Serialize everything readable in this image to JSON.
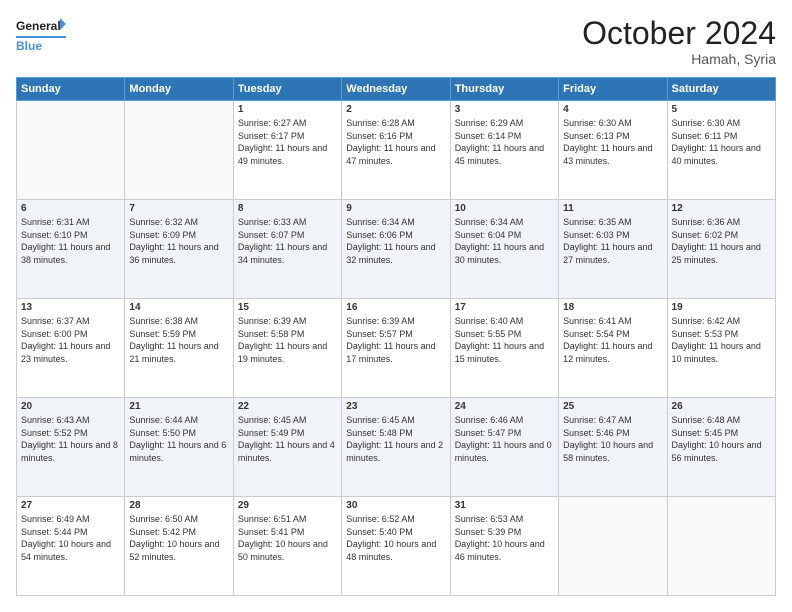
{
  "logo": {
    "line1": "General",
    "line2": "Blue"
  },
  "header": {
    "month": "October 2024",
    "location": "Hamah, Syria"
  },
  "weekdays": [
    "Sunday",
    "Monday",
    "Tuesday",
    "Wednesday",
    "Thursday",
    "Friday",
    "Saturday"
  ],
  "rows": [
    [
      {
        "day": "",
        "info": ""
      },
      {
        "day": "",
        "info": ""
      },
      {
        "day": "1",
        "info": "Sunrise: 6:27 AM\nSunset: 6:17 PM\nDaylight: 11 hours and 49 minutes."
      },
      {
        "day": "2",
        "info": "Sunrise: 6:28 AM\nSunset: 6:16 PM\nDaylight: 11 hours and 47 minutes."
      },
      {
        "day": "3",
        "info": "Sunrise: 6:29 AM\nSunset: 6:14 PM\nDaylight: 11 hours and 45 minutes."
      },
      {
        "day": "4",
        "info": "Sunrise: 6:30 AM\nSunset: 6:13 PM\nDaylight: 11 hours and 43 minutes."
      },
      {
        "day": "5",
        "info": "Sunrise: 6:30 AM\nSunset: 6:11 PM\nDaylight: 11 hours and 40 minutes."
      }
    ],
    [
      {
        "day": "6",
        "info": "Sunrise: 6:31 AM\nSunset: 6:10 PM\nDaylight: 11 hours and 38 minutes."
      },
      {
        "day": "7",
        "info": "Sunrise: 6:32 AM\nSunset: 6:09 PM\nDaylight: 11 hours and 36 minutes."
      },
      {
        "day": "8",
        "info": "Sunrise: 6:33 AM\nSunset: 6:07 PM\nDaylight: 11 hours and 34 minutes."
      },
      {
        "day": "9",
        "info": "Sunrise: 6:34 AM\nSunset: 6:06 PM\nDaylight: 11 hours and 32 minutes."
      },
      {
        "day": "10",
        "info": "Sunrise: 6:34 AM\nSunset: 6:04 PM\nDaylight: 11 hours and 30 minutes."
      },
      {
        "day": "11",
        "info": "Sunrise: 6:35 AM\nSunset: 6:03 PM\nDaylight: 11 hours and 27 minutes."
      },
      {
        "day": "12",
        "info": "Sunrise: 6:36 AM\nSunset: 6:02 PM\nDaylight: 11 hours and 25 minutes."
      }
    ],
    [
      {
        "day": "13",
        "info": "Sunrise: 6:37 AM\nSunset: 6:00 PM\nDaylight: 11 hours and 23 minutes."
      },
      {
        "day": "14",
        "info": "Sunrise: 6:38 AM\nSunset: 5:59 PM\nDaylight: 11 hours and 21 minutes."
      },
      {
        "day": "15",
        "info": "Sunrise: 6:39 AM\nSunset: 5:58 PM\nDaylight: 11 hours and 19 minutes."
      },
      {
        "day": "16",
        "info": "Sunrise: 6:39 AM\nSunset: 5:57 PM\nDaylight: 11 hours and 17 minutes."
      },
      {
        "day": "17",
        "info": "Sunrise: 6:40 AM\nSunset: 5:55 PM\nDaylight: 11 hours and 15 minutes."
      },
      {
        "day": "18",
        "info": "Sunrise: 6:41 AM\nSunset: 5:54 PM\nDaylight: 11 hours and 12 minutes."
      },
      {
        "day": "19",
        "info": "Sunrise: 6:42 AM\nSunset: 5:53 PM\nDaylight: 11 hours and 10 minutes."
      }
    ],
    [
      {
        "day": "20",
        "info": "Sunrise: 6:43 AM\nSunset: 5:52 PM\nDaylight: 11 hours and 8 minutes."
      },
      {
        "day": "21",
        "info": "Sunrise: 6:44 AM\nSunset: 5:50 PM\nDaylight: 11 hours and 6 minutes."
      },
      {
        "day": "22",
        "info": "Sunrise: 6:45 AM\nSunset: 5:49 PM\nDaylight: 11 hours and 4 minutes."
      },
      {
        "day": "23",
        "info": "Sunrise: 6:45 AM\nSunset: 5:48 PM\nDaylight: 11 hours and 2 minutes."
      },
      {
        "day": "24",
        "info": "Sunrise: 6:46 AM\nSunset: 5:47 PM\nDaylight: 11 hours and 0 minutes."
      },
      {
        "day": "25",
        "info": "Sunrise: 6:47 AM\nSunset: 5:46 PM\nDaylight: 10 hours and 58 minutes."
      },
      {
        "day": "26",
        "info": "Sunrise: 6:48 AM\nSunset: 5:45 PM\nDaylight: 10 hours and 56 minutes."
      }
    ],
    [
      {
        "day": "27",
        "info": "Sunrise: 6:49 AM\nSunset: 5:44 PM\nDaylight: 10 hours and 54 minutes."
      },
      {
        "day": "28",
        "info": "Sunrise: 6:50 AM\nSunset: 5:42 PM\nDaylight: 10 hours and 52 minutes."
      },
      {
        "day": "29",
        "info": "Sunrise: 6:51 AM\nSunset: 5:41 PM\nDaylight: 10 hours and 50 minutes."
      },
      {
        "day": "30",
        "info": "Sunrise: 6:52 AM\nSunset: 5:40 PM\nDaylight: 10 hours and 48 minutes."
      },
      {
        "day": "31",
        "info": "Sunrise: 6:53 AM\nSunset: 5:39 PM\nDaylight: 10 hours and 46 minutes."
      },
      {
        "day": "",
        "info": ""
      },
      {
        "day": "",
        "info": ""
      }
    ]
  ]
}
